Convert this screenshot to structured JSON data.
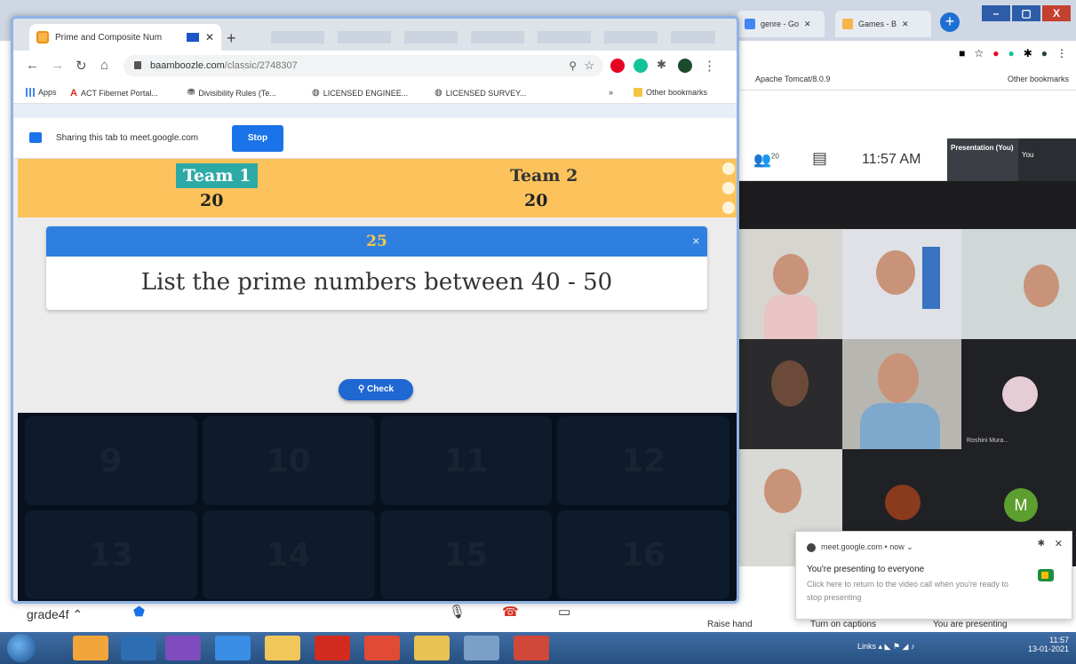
{
  "background_browser": {
    "tabs": [
      "genre - Go",
      "Games - B"
    ],
    "window_controls": [
      "–",
      "▢",
      "X"
    ],
    "bookmarks": [
      "Apache Tomcat/8.0.9",
      "Other bookmarks"
    ]
  },
  "meet": {
    "participants_count": "20",
    "time": "11:57 AM",
    "presentation_label": "Presentation (You)",
    "you_label": "You",
    "tiles": [
      {
        "kind": "video",
        "bg": "#d7d5d0"
      },
      {
        "kind": "video",
        "bg": "#dfe1e6"
      },
      {
        "kind": "video",
        "bg": "#cfd8d6"
      },
      {
        "kind": "video",
        "bg": "#2b2a2c"
      },
      {
        "kind": "video",
        "bg": "#b8b6b0"
      },
      {
        "kind": "avatar-photo",
        "bg": "#202124",
        "name": "Roshini Mura..."
      },
      {
        "kind": "video",
        "bg": "#d9d9d5"
      },
      {
        "kind": "avatar-photo",
        "bg": "#202124"
      },
      {
        "kind": "letter",
        "bg": "#202124",
        "letter": "M"
      }
    ],
    "bottom": {
      "meeting_name": "grade4f",
      "raise_hand": "Raise hand",
      "turn_on_captions": "Turn on captions",
      "you_are_presenting": "You are presenting"
    }
  },
  "notification": {
    "source": "meet.google.com • now ⌄",
    "title": "You're presenting to everyone",
    "body": "Click here to return to the video call when you're ready to stop presenting"
  },
  "browser": {
    "tab_title": "Prime and Composite Num",
    "address": {
      "host": "baamboozle.com",
      "path": "/classic/2748307"
    },
    "bookmarks": [
      "Apps",
      "ACT Fibernet Portal...",
      "Divisibility Rules (Te...",
      "LICENSED ENGINEE...",
      "LICENSED SURVEY...",
      "»",
      "Other bookmarks"
    ],
    "share_text": "Sharing this tab to meet.google.com",
    "stop_label": "Stop"
  },
  "game": {
    "team1": {
      "name": "Team 1",
      "score": "20"
    },
    "team2": {
      "name": "Team 2",
      "score": "20"
    },
    "points": "25",
    "close_label": "×",
    "question": "List the prime numbers between 40 - 50",
    "check_label": "Check",
    "tiles": [
      "9",
      "10",
      "11",
      "12",
      "13",
      "14",
      "15",
      "16"
    ]
  },
  "taskbar": {
    "links_label": "Links",
    "time": "11:57",
    "date": "13-01-2021",
    "apps": [
      {
        "name": "windows-explorer",
        "color": "#f2a53a"
      },
      {
        "name": "virtual-machine",
        "color": "#2d6db1"
      },
      {
        "name": "visual-studio",
        "color": "#7e4cbe"
      },
      {
        "name": "internet-explorer",
        "color": "#3a8ee6"
      },
      {
        "name": "file-explorer",
        "color": "#f1c75a"
      },
      {
        "name": "acrobat",
        "color": "#d32b1f"
      },
      {
        "name": "chrome",
        "color": "#e14b36"
      },
      {
        "name": "folder",
        "color": "#e8c253"
      },
      {
        "name": "notepad",
        "color": "#7aa0c9"
      },
      {
        "name": "powerpoint",
        "color": "#d0473a"
      }
    ]
  },
  "colors": {
    "team_bar": "#fcc35c",
    "active_team": "#2eaaa6",
    "question_header": "#2f7fe0",
    "tile_bg": "#0d1b2c"
  }
}
